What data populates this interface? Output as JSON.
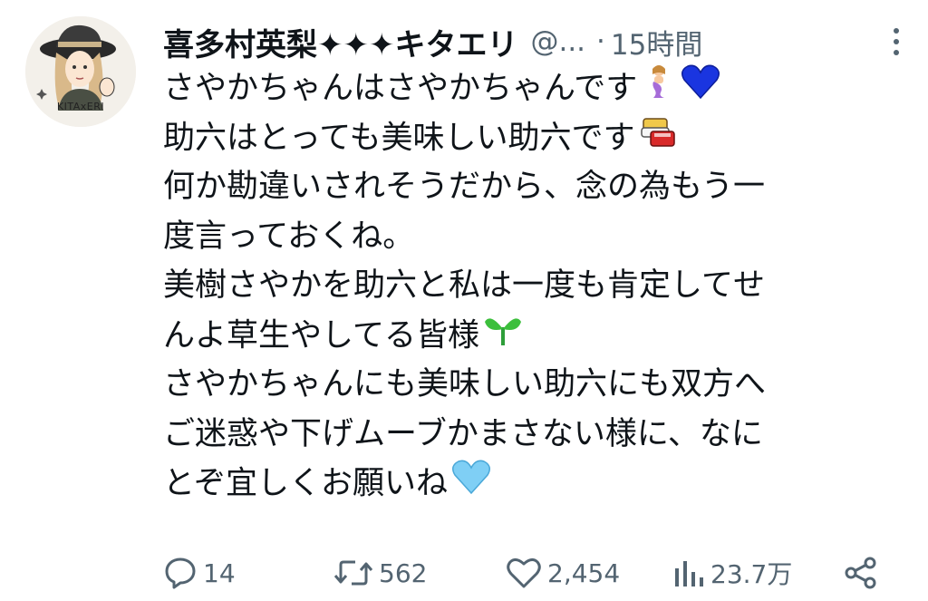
{
  "tweet": {
    "author": {
      "display_name": "喜多村英梨✦✦✦キタエリ",
      "handle": "@...",
      "avatar_caption": "KITAxERI"
    },
    "separator": "·",
    "timestamp": "15時間",
    "text_lines": [
      "さやかちゃんはさやかちゃんです",
      "助六はとっても美味しい助六です",
      "何か勘違いされそうだから、念の為もう一",
      "度言っておくね。",
      "美樹さやかを助六と私は一度も肯定してせ",
      "んよ草生やしてる皆様",
      "さやかちゃんにも美味しい助六にも双方へ",
      "ご迷惑や下げムーブかまさない様に、なに",
      "とぞ宜しくお願いね"
    ],
    "emojis": {
      "line0": [
        "mermaid-emoji",
        "blue-heart-emoji"
      ],
      "line1": [
        "sushi-box-emoji"
      ],
      "line5": [
        "seedling-emoji"
      ],
      "line8": [
        "light-blue-heart-emoji"
      ]
    },
    "metrics": {
      "replies": "14",
      "retweets": "562",
      "likes": "2,454",
      "views": "23.7万"
    },
    "icons": {
      "reply": "speech-bubble-icon",
      "retweet": "retweet-icon",
      "like": "heart-icon",
      "views": "bar-chart-icon",
      "share": "share-icon",
      "more": "more-vertical-icon"
    },
    "colors": {
      "text": "#0f1419",
      "secondary": "#536471",
      "heart_blue": "#1a35e0",
      "heart_light_blue": "#7fcff5",
      "seedling_green": "#3cbf3c"
    }
  }
}
